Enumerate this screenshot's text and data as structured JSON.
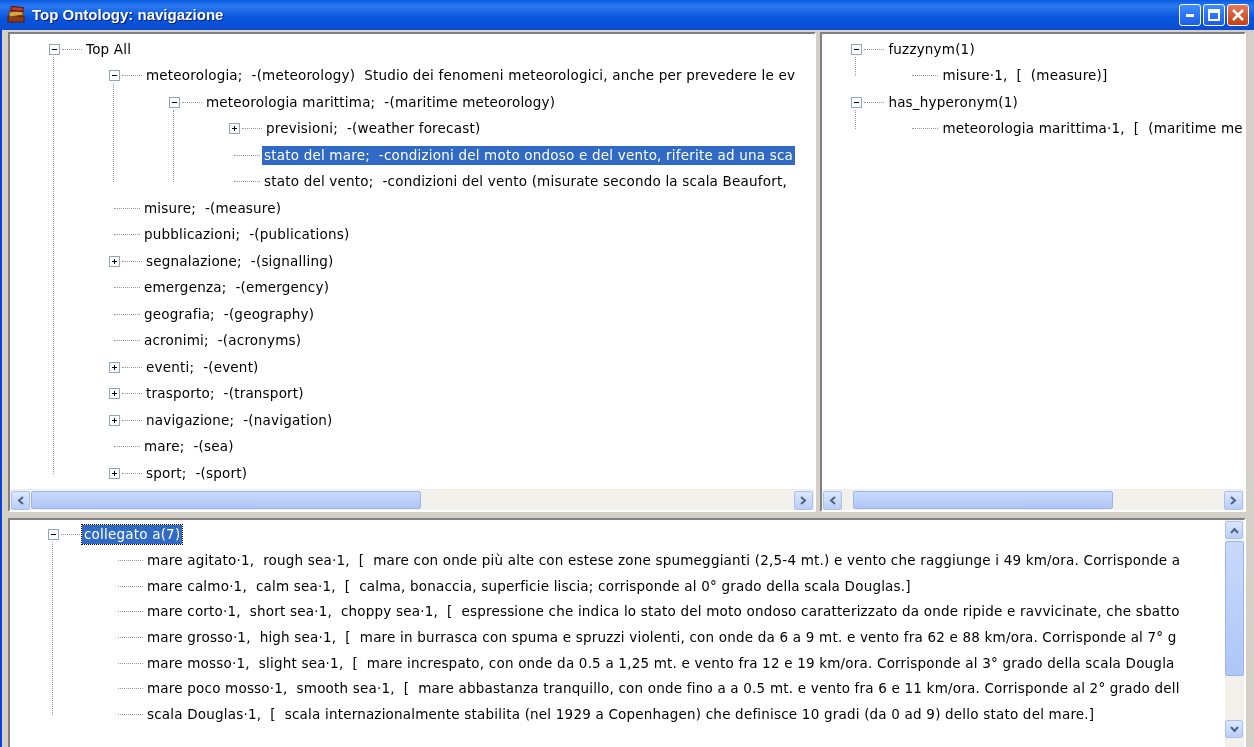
{
  "window": {
    "title": "Top Ontology: navigazione"
  },
  "concept_tree": {
    "nodes": [
      {
        "label": "Top All",
        "expanded": true,
        "selected": false,
        "children": [
          {
            "label": "meteorologia;  -(meteorology)  Studio dei fenomeni meteorologici, anche per prevedere le ev",
            "expanded": true,
            "selected": false,
            "children": [
              {
                "label": "meteorologia marittima;  -(maritime meteorology)",
                "expanded": true,
                "selected": false,
                "children": [
                  {
                    "label": "previsioni;  -(weather forecast)",
                    "expanded": false,
                    "selected": false
                  },
                  {
                    "label": "stato del mare;  -condizioni del moto ondoso e del vento, riferite ad una sca",
                    "selected": true
                  },
                  {
                    "label": "stato del vento;  -condizioni del vento (misurate secondo la scala Beaufort,",
                    "selected": false
                  }
                ]
              }
            ]
          },
          {
            "label": "misure;  -(measure)",
            "selected": false
          },
          {
            "label": "pubblicazioni;  -(publications)",
            "selected": false
          },
          {
            "label": "segnalazione;  -(signalling)",
            "expanded": false,
            "selected": false
          },
          {
            "label": "emergenza;  -(emergency)",
            "selected": false
          },
          {
            "label": "geografia;  -(geography)",
            "selected": false
          },
          {
            "label": "acronimi;  -(acronyms)",
            "selected": false
          },
          {
            "label": "eventi;  -(event)",
            "expanded": false,
            "selected": false
          },
          {
            "label": "trasporto;  -(transport)",
            "expanded": false,
            "selected": false
          },
          {
            "label": "navigazione;  -(navigation)",
            "expanded": false,
            "selected": false
          },
          {
            "label": "mare;  -(sea)",
            "selected": false
          },
          {
            "label": "sport;  -(sport)",
            "expanded": false,
            "selected": false
          }
        ]
      }
    ]
  },
  "relations_tree": {
    "nodes": [
      {
        "label": "fuzzynym(1)",
        "expanded": true,
        "selected": false,
        "children": [
          {
            "label": "misure·1,  [  (measure)]",
            "selected": false
          }
        ]
      },
      {
        "label": "has_hyperonym(1)",
        "expanded": true,
        "selected": false,
        "children": [
          {
            "label": "meteorologia marittima·1,  [  (maritime me",
            "selected": false
          }
        ]
      }
    ]
  },
  "related_tree": {
    "nodes": [
      {
        "label": "collegato a(7)",
        "expanded": true,
        "selected": true,
        "children": [
          {
            "label": "mare agitato·1,  rough sea·1,  [  mare con onde più alte con estese zone spumeggianti (2,5-4 mt.) e vento che raggiunge i 49 km/ora. Corrisponde a",
            "selected": false
          },
          {
            "label": "mare calmo·1,  calm sea·1,  [  calma, bonaccia, superficie liscia; corrisponde al 0° grado della scala Douglas.]",
            "selected": false
          },
          {
            "label": "mare corto·1,  short sea·1,  choppy sea·1,  [  espressione che indica lo stato del moto ondoso caratterizzato da onde ripide e ravvicinate, che sbatto",
            "selected": false
          },
          {
            "label": "mare grosso·1,  high sea·1,  [  mare in burrasca con spuma e spruzzi violenti, con onde da 6 a 9 mt. e vento fra 62 e 88 km/ora. Corrisponde al 7° g",
            "selected": false
          },
          {
            "label": "mare mosso·1,  slight sea·1,  [  mare increspato, con onde da 0.5 a 1,25 mt. e vento fra 12 e 19 km/ora. Corrisponde al 3° grado della scala Dougla",
            "selected": false
          },
          {
            "label": "mare poco mosso·1,  smooth sea·1,  [  mare abbastanza tranquillo, con onde fino a a 0.5 mt. e vento fra 6 e 11 km/ora. Corrisponde al 2° grado dell",
            "selected": false
          },
          {
            "label": "scala Douglas·1,  [  scala internazionalmente stabilita (nel 1929 a Copenhagen) che definisce 10 gradi (da 0 ad 9) dello stato del mare.]",
            "selected": false
          }
        ]
      }
    ]
  }
}
